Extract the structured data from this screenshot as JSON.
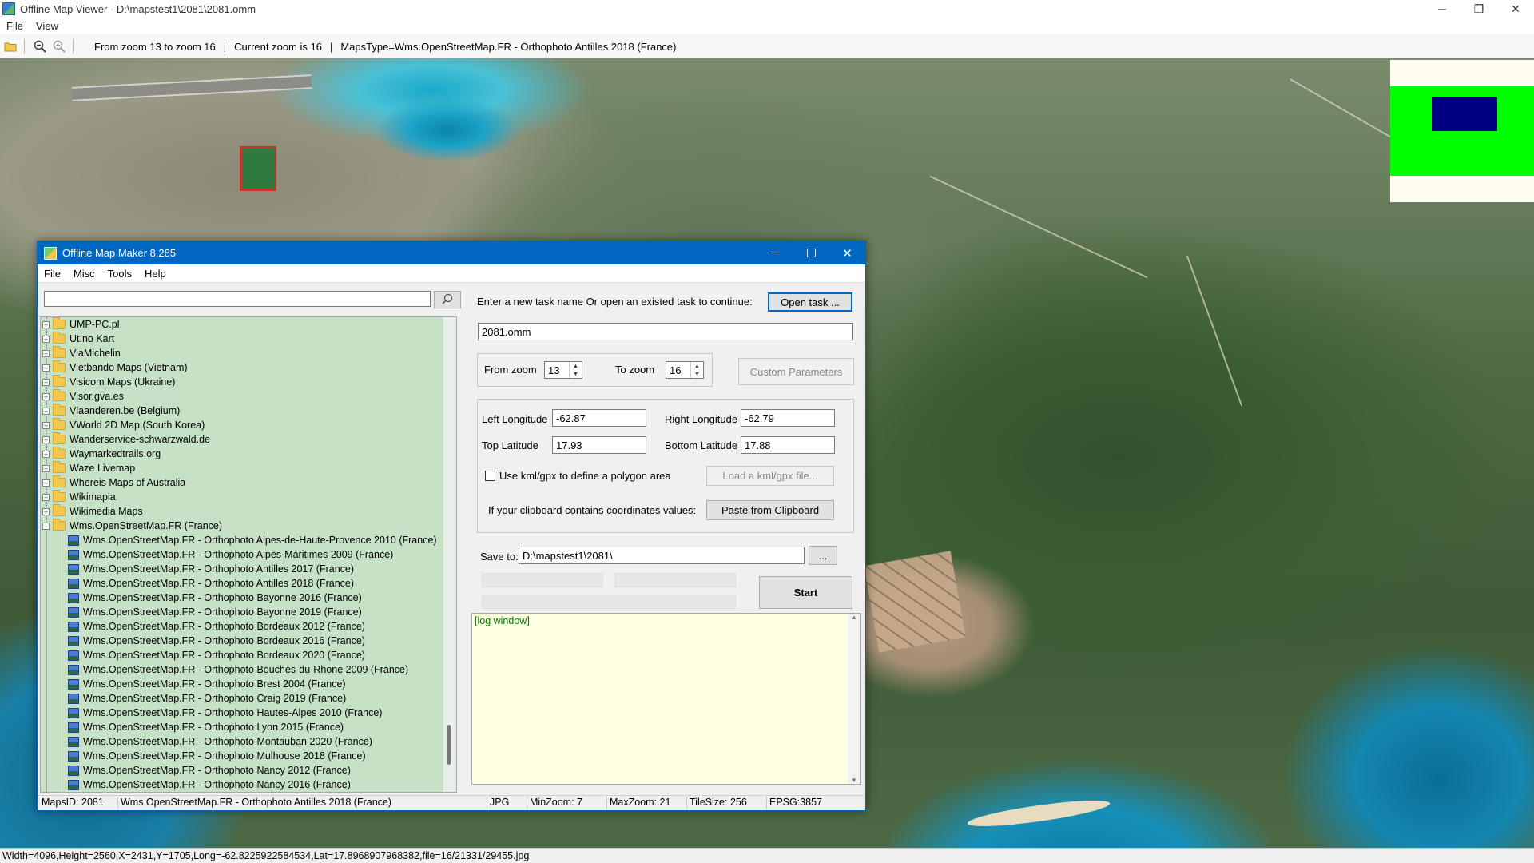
{
  "window": {
    "title": "Offline Map Viewer - D:\\mapstest1\\2081\\2081.omm",
    "controls": [
      "─",
      "❐",
      "✕"
    ]
  },
  "menu": [
    "File",
    "View"
  ],
  "toolbar": {
    "zoom_range": "From zoom 13 to zoom 16",
    "current_zoom": "Current zoom is 16",
    "maps_type": "MapsType=Wms.OpenStreetMap.FR - Orthophoto Antilles 2018 (France)",
    "separator": "|",
    "icons": [
      "open-folder-icon",
      "zoom-out-icon",
      "zoom-in-icon"
    ]
  },
  "status_bar": "Width=4096,Height=2560,X=2431,Y=1705,Long=-62.8225922584534,Lat=17.8968907968382,file=16/21331/29455.jpg",
  "overview": {
    "accent": "#00ff00",
    "view_rect_color": "#000080"
  },
  "dialog": {
    "title": "Offline Map Maker 8.285",
    "controls": [
      "─",
      "☐",
      "✕"
    ],
    "menu": [
      "File",
      "Misc",
      "Tools",
      "Help"
    ],
    "search": {
      "value": "",
      "icon": "search-icon"
    },
    "tree": {
      "folders": [
        "UMP-PC.pl",
        "Ut.no Kart",
        "ViaMichelin",
        "Vietbando Maps (Vietnam)",
        "Visicom Maps (Ukraine)",
        "Visor.gva.es",
        "Vlaanderen.be (Belgium)",
        "VWorld 2D Map (South Korea)",
        "Wanderservice-schwarzwald.de",
        "Waymarkedtrails.org",
        "Waze Livemap",
        "Whereis Maps of Australia",
        "Wikimapia",
        "Wikimedia Maps"
      ],
      "expanded_folder": "Wms.OpenStreetMap.FR (France)",
      "children": [
        "Wms.OpenStreetMap.FR - Orthophoto Alpes-de-Haute-Provence 2010 (France)",
        "Wms.OpenStreetMap.FR - Orthophoto Alpes-Maritimes 2009 (France)",
        "Wms.OpenStreetMap.FR - Orthophoto Antilles 2017 (France)",
        "Wms.OpenStreetMap.FR - Orthophoto Antilles 2018 (France)",
        "Wms.OpenStreetMap.FR - Orthophoto Bayonne 2016 (France)",
        "Wms.OpenStreetMap.FR - Orthophoto Bayonne 2019 (France)",
        "Wms.OpenStreetMap.FR - Orthophoto Bordeaux 2012 (France)",
        "Wms.OpenStreetMap.FR - Orthophoto Bordeaux 2016 (France)",
        "Wms.OpenStreetMap.FR - Orthophoto Bordeaux 2020 (France)",
        "Wms.OpenStreetMap.FR - Orthophoto Bouches-du-Rhone 2009 (France)",
        "Wms.OpenStreetMap.FR - Orthophoto Brest 2004 (France)",
        "Wms.OpenStreetMap.FR - Orthophoto Craig 2019 (France)",
        "Wms.OpenStreetMap.FR - Orthophoto Hautes-Alpes 2010 (France)",
        "Wms.OpenStreetMap.FR - Orthophoto Lyon 2015 (France)",
        "Wms.OpenStreetMap.FR - Orthophoto Montauban 2020 (France)",
        "Wms.OpenStreetMap.FR - Orthophoto Mulhouse 2018 (France)",
        "Wms.OpenStreetMap.FR - Orthophoto Nancy 2012 (France)",
        "Wms.OpenStreetMap.FR - Orthophoto Nancy 2016 (France)"
      ],
      "selected": "Wms.OpenStreetMap.FR - Orthophoto Antilles 2018 (France)",
      "background_color": "#c7e1c6"
    },
    "task": {
      "prompt": "Enter a new task name Or open an existed task to continue:",
      "open_button": "Open task ...",
      "name_value": "2081.omm"
    },
    "zoom": {
      "from_label": "From zoom",
      "from_value": "13",
      "to_label": "To zoom",
      "to_value": "16",
      "custom_button": "Custom Parameters"
    },
    "coords": {
      "left_label": "Left Longitude",
      "left_value": "-62.87",
      "right_label": "Right Longitude",
      "right_value": "-62.79",
      "top_label": "Top Latitude",
      "top_value": "17.93",
      "bottom_label": "Bottom Latitude",
      "bottom_value": "17.88"
    },
    "kml": {
      "checkbox_label": "Use kml/gpx to define a polygon area",
      "load_button": "Load a kml/gpx file..."
    },
    "clipboard": {
      "label": "If your clipboard contains coordinates values:",
      "button": "Paste from Clipboard"
    },
    "save": {
      "label": "Save to:",
      "value": "D:\\mapstest1\\2081\\",
      "browse_button": "..."
    },
    "start_button": "Start",
    "log": {
      "text": "[log window]"
    },
    "status": {
      "maps_id": "MapsID: 2081",
      "maps_name": "Wms.OpenStreetMap.FR - Orthophoto Antilles 2018 (France)",
      "format": "JPG",
      "min_zoom": "MinZoom: 7",
      "max_zoom": "MaxZoom: 21",
      "tile_size": "TileSize: 256",
      "epsg": "EPSG:3857"
    }
  }
}
